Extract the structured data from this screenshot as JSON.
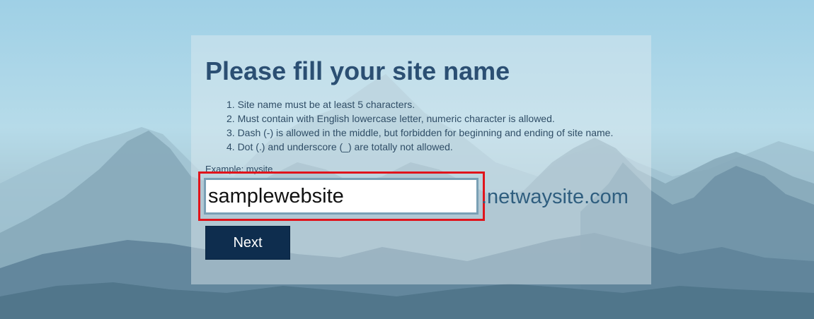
{
  "form": {
    "title": "Please fill your site name",
    "rules": [
      "1. Site name must be at least 5 characters.",
      "2. Must contain with English lowercase letter, numeric character is allowed.",
      "3. Dash (-) is allowed in the middle, but forbidden for beginning and ending of site name.",
      "4. Dot (.) and underscore (_) are totally not allowed."
    ],
    "example": "Example: mysite",
    "site_name_value": "samplewebsite",
    "domain_suffix": ".netwaysite.com",
    "next_label": "Next"
  },
  "colors": {
    "title": "#2b4f73",
    "button": "#0e2d4e",
    "highlight": "#e0141b"
  }
}
